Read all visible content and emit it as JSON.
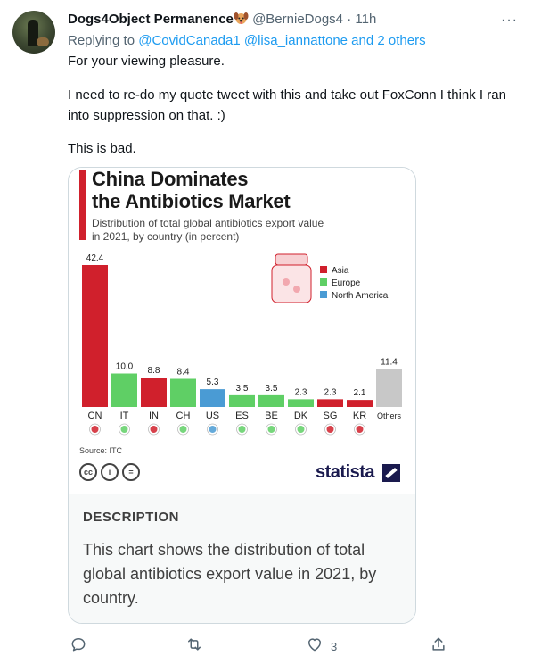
{
  "tweet": {
    "display_name": "Dogs4Object Permanence",
    "handle": "@BernieDogs4",
    "separator": "·",
    "time": "11h",
    "replying_to": {
      "prefix": "Replying to",
      "mention1": "@CovidCanada1",
      "mention2": "@lisa_iannattone",
      "and_others": "and 2 others"
    },
    "lines": [
      "For your viewing pleasure.",
      "I need to re-do my quote tweet with this and take out FoxConn I think I ran",
      "into suppression on that. :)",
      "This is bad."
    ],
    "more_label": "···"
  },
  "card": {
    "chart": {
      "title_line1": "China Dominates",
      "title_line2": "the Antibiotics Market",
      "subtitle_line1": "Distribution of total global antibiotics export value",
      "subtitle_line2": "in 2021, by country (in percent)",
      "source": "Source: ITC",
      "brand": "statista",
      "license_icons": [
        "cc-icon",
        "by-icon",
        "nd-icon"
      ]
    },
    "description_heading": "DESCRIPTION",
    "description_lines": [
      "This chart shows the distribution of total",
      "global antibiotics export value in 2021, by",
      "country."
    ]
  },
  "chart_data": {
    "type": "bar",
    "title": "China Dominates the Antibiotics Market",
    "subtitle": "Distribution of total global antibiotics export value in 2021, by country (in percent)",
    "categories": [
      "CN",
      "IT",
      "IN",
      "CH",
      "US",
      "ES",
      "BE",
      "DK",
      "SG",
      "KR",
      "Others"
    ],
    "values": [
      42.4,
      10.0,
      8.8,
      8.4,
      5.3,
      3.5,
      3.5,
      2.3,
      2.3,
      2.1,
      11.4
    ],
    "value_labels": [
      "42.4",
      "10.0",
      "8.8",
      "8.4",
      "5.3",
      "3.5",
      "3.5",
      "2.3",
      "2.3",
      "2.1",
      "11.4"
    ],
    "regions": [
      "Asia",
      "Europe",
      "Asia",
      "Europe",
      "North America",
      "Europe",
      "Europe",
      "Europe",
      "Asia",
      "Asia",
      "Other"
    ],
    "legend": [
      {
        "name": "Asia",
        "color": "#d0202c"
      },
      {
        "name": "Europe",
        "color": "#5fcf65"
      },
      {
        "name": "North America",
        "color": "#4a9bd4"
      }
    ],
    "other_color": "#c8c8c8",
    "ylim": [
      0,
      42.4
    ],
    "legend_position": "top-right",
    "grid": false
  },
  "actions": {
    "like_count": "3"
  }
}
